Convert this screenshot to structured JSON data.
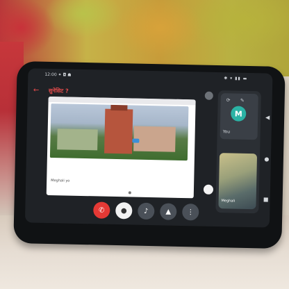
{
  "scene": {
    "status_time": "12:00 ✦ ◘ ☗",
    "status_icons": "✱ ▾ ▮▮ ▬",
    "call_title": "सुनेसिट ?",
    "sender_label": "Meghali yo",
    "self_tile_label": "You",
    "self_avatar_letter": "M",
    "other_tile_label": "Meghali"
  },
  "controls": {
    "end_call_color": "#e53935",
    "accent_teal": "#2bb3a5"
  }
}
